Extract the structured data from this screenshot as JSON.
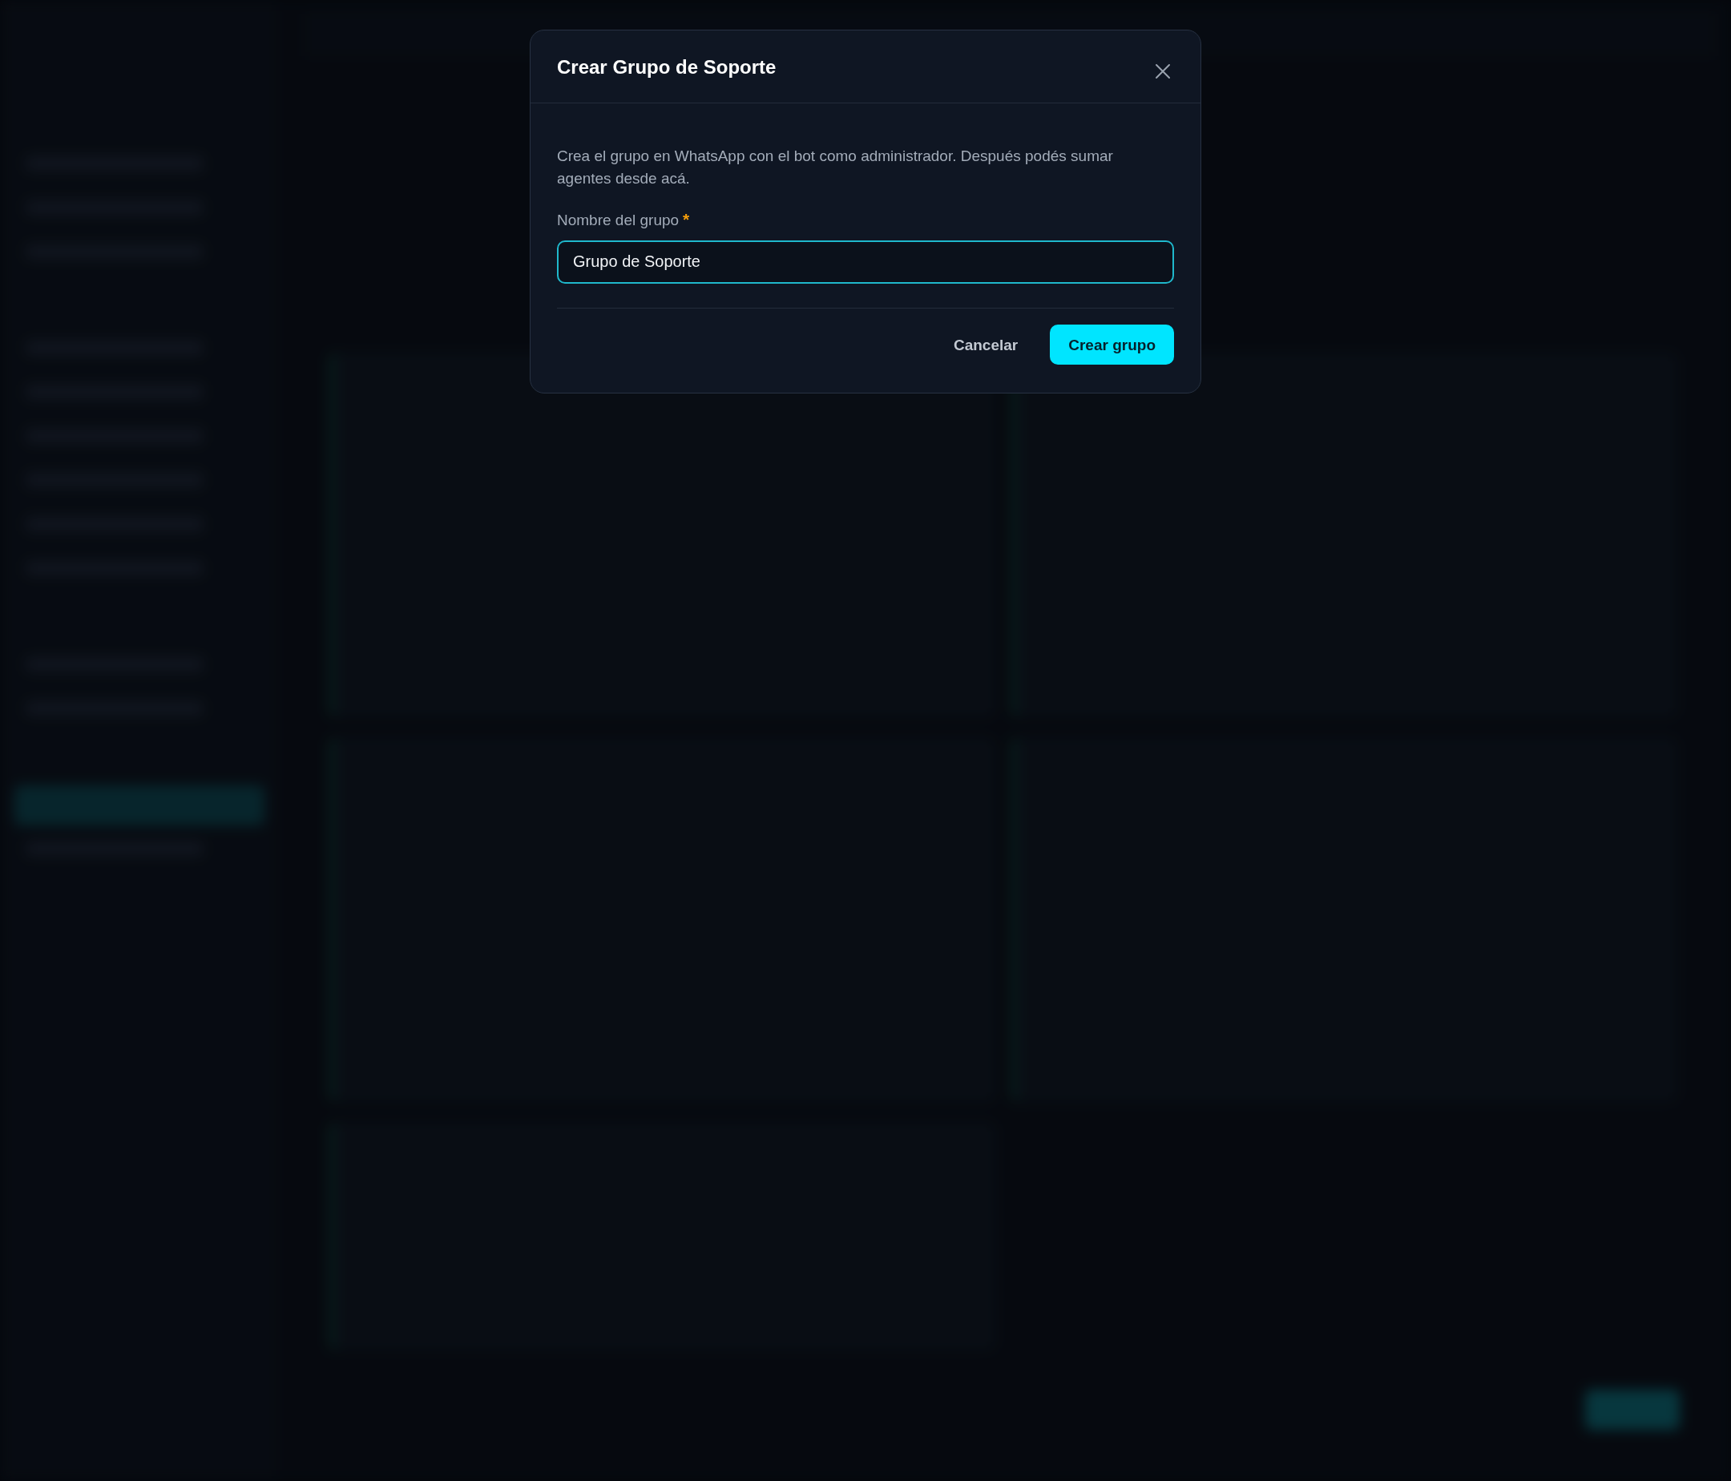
{
  "dialog": {
    "title": "Crear Grupo de Soporte",
    "description": "Crea el grupo en WhatsApp con el bot como administrador. Después podés sumar agentes desde acá.",
    "field": {
      "label": "Nombre del grupo",
      "required_mark": "*",
      "value": "Grupo de Soporte",
      "focused": true
    },
    "buttons": [
      {
        "label": "Cancelar",
        "kind": "secondary"
      },
      {
        "label": "Crear grupo",
        "kind": "primary"
      }
    ]
  }
}
